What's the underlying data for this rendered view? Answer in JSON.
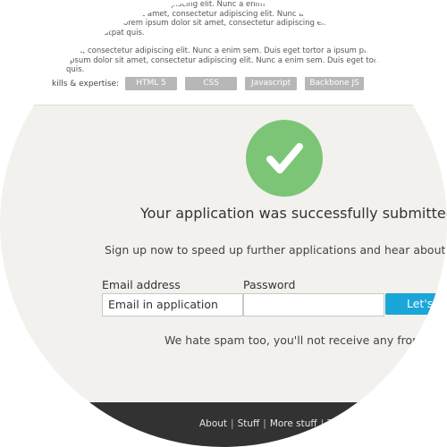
{
  "background_text": {
    "lines": [
      "r adipiscing elit. Nunc a enim",
      "t sit amet, consectetur adipiscing elit. Nunc a enim",
      "orem ipsum dolor sit amet, consectetur adipiscing elit. Nunc a enim",
      "utpat quis.",
      "",
      "et, consectetur adipiscing elit. Nunc a enim sem. Duis eget tortor a ipsum placerat co",
      "psum dolor sit amet, consectetur adipiscing elit. Nunc a enim sem. Duis eget tortor a",
      "quis."
    ],
    "skills_label": "kills & expertise:",
    "skill_tags": [
      "HTML 5",
      "CSS",
      "Javascript",
      "Backbone JS"
    ]
  },
  "confirmation": {
    "check_icon": "checkmark-icon",
    "check_color": "#7cc576",
    "headline": "Your application was successfully submitted",
    "subline": "Sign up now to speed up further applications and hear about similar j"
  },
  "signup_form": {
    "email_label": "Email address",
    "email_value": "Email in application",
    "password_label": "Password",
    "password_value": "",
    "submit_label": "Let's",
    "submit_color": "#1aa6d8"
  },
  "spam_note": "We hate spam too, you'll not receive any from us.",
  "footer": {
    "links": [
      "About",
      "Stuff",
      "More stuff",
      "Ter"
    ]
  }
}
